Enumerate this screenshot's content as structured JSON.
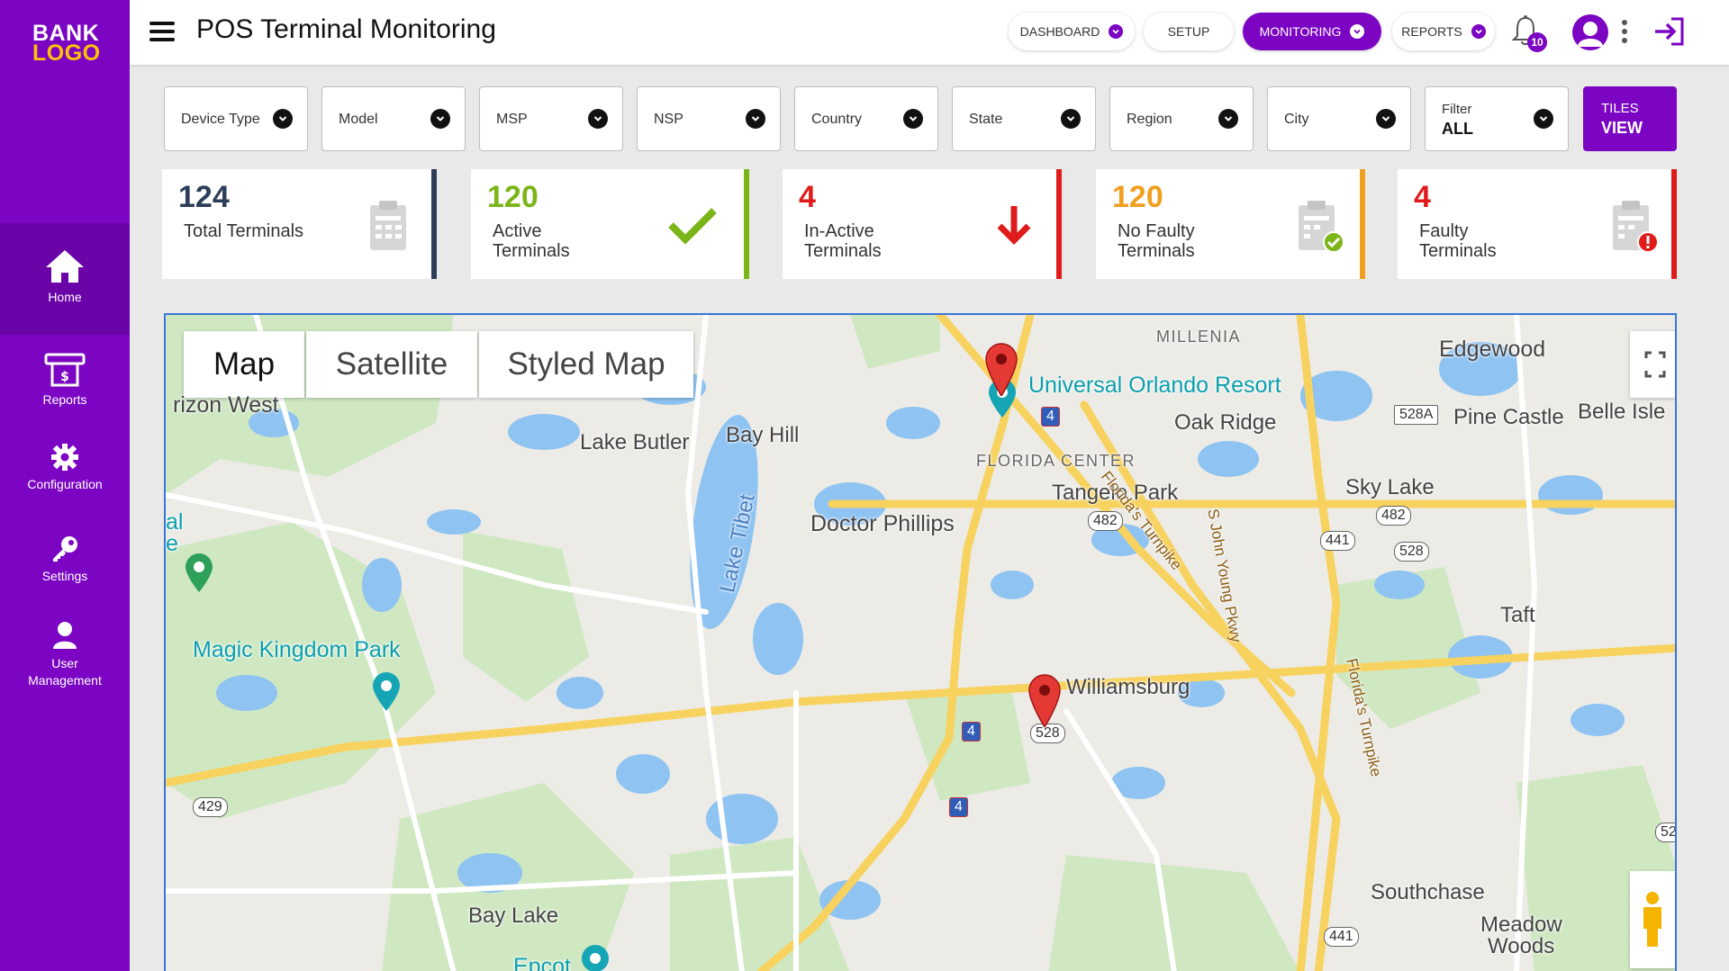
{
  "brand": {
    "logo_line1": "BANK",
    "logo_line2": "LOGO",
    "accent": "#7b05c2",
    "logo_accent": "#ffc107"
  },
  "sidebar": {
    "items": [
      {
        "label": "Home",
        "icon": "home-icon",
        "active": true
      },
      {
        "label": "Reports",
        "icon": "reports-icon"
      },
      {
        "label": "Configuration",
        "icon": "gear-icon"
      },
      {
        "label": "Settings",
        "icon": "key-icon"
      },
      {
        "label": "User Management",
        "icon": "user-icon"
      }
    ]
  },
  "header": {
    "title": "POS Terminal Monitoring",
    "nav": [
      {
        "label": "DASHBOARD",
        "has_chevron": true
      },
      {
        "label": "SETUP",
        "has_chevron": false
      },
      {
        "label": "MONITORING",
        "has_chevron": true,
        "active": true
      },
      {
        "label": "REPORTS",
        "has_chevron": true
      }
    ],
    "notification_count": "10"
  },
  "filters": [
    {
      "label": "Device Type"
    },
    {
      "label": "Model"
    },
    {
      "label": "MSP"
    },
    {
      "label": "NSP"
    },
    {
      "label": "Country"
    },
    {
      "label": "State"
    },
    {
      "label": "Region"
    },
    {
      "label": "City"
    }
  ],
  "filter_all": {
    "small": "Filter",
    "big": "ALL"
  },
  "tiles_view": {
    "small": "TILES",
    "big": "VIEW"
  },
  "stats": [
    {
      "value": "124",
      "label": "Total Terminals",
      "color": "#2c3e5a",
      "bar": "#2c3e5a",
      "icon": "clipboard-icon"
    },
    {
      "value": "120",
      "label": "Active Terminals",
      "color": "#7cb518",
      "bar": "#7cb518",
      "icon": "checkmark-icon"
    },
    {
      "value": "4",
      "label": "In-Active Terminals",
      "color": "#e01b1b",
      "bar": "#e01b1b",
      "icon": "arrow-down-icon"
    },
    {
      "value": "120",
      "label": "No Faulty Terminals",
      "color": "#f0a020",
      "bar": "#f0a020",
      "icon": "clipboard-check-icon"
    },
    {
      "value": "4",
      "label": "Faulty Terminals",
      "color": "#e01b1b",
      "bar": "#e01b1b",
      "icon": "clipboard-error-icon"
    }
  ],
  "map": {
    "types": [
      "Map",
      "Satellite",
      "Styled Map"
    ],
    "active_type": "Map",
    "places": {
      "horizon_west": "rizon West",
      "lake_butler": "Lake Butler",
      "bay_hill": "Bay Hill",
      "lake_tibet": "Lake Tibet",
      "doctor_phillips": "Doctor Phillips",
      "millenia": "MILLENIA",
      "universal": "Universal Orlando Resort",
      "oak_ridge": "Oak Ridge",
      "florida_center": "FLORIDA CENTER",
      "tangelo_park": "Tangelo Park",
      "florida_turnpike": "Florida's Turnpike",
      "john_young": "S John Young Pkwy",
      "edgewood": "Edgewood",
      "pine_castle": "Pine Castle",
      "belle_isle": "Belle Isle",
      "sky_lake": "Sky Lake",
      "taft": "Taft",
      "magic_kingdom": "Magic Kingdom Park",
      "williamsburg": "Williamsburg",
      "bay_lake": "Bay Lake",
      "epcot": "Epcot",
      "southchase": "Southchase",
      "meadow_woods_1": "Meadow",
      "meadow_woods_2": "Woods",
      "florida_turnpike_2": "Florida's Turnpike",
      "el": "al",
      "el2": "e"
    },
    "shields": {
      "i4_a": "4",
      "i4_b": "4",
      "i4_c": "4",
      "r528a": "528A",
      "r482a": "482",
      "r482b": "482",
      "r441a": "441",
      "r441b": "441",
      "r528b": "528",
      "r528c": "528",
      "r429": "429",
      "r52": "52"
    }
  }
}
